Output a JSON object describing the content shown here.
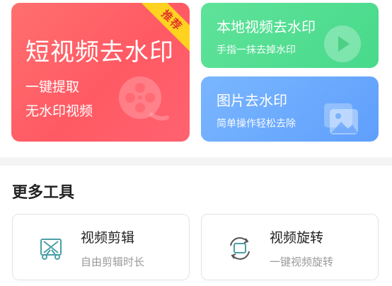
{
  "main_card": {
    "title": "短视频去水印",
    "line1": "一键提取",
    "line2": "无水印视频",
    "badge": "推荐",
    "icon": "film-reel-icon"
  },
  "local_card": {
    "title": "本地视频去水印",
    "subtitle": "手指一抹去掉水印",
    "icon": "play-icon"
  },
  "image_card": {
    "title": "图片去水印",
    "subtitle": "简单操作轻松去除",
    "icon": "gallery-icon"
  },
  "more_tools": {
    "title": "更多工具",
    "items": [
      {
        "name": "视频剪辑",
        "subtitle": "自由剪辑时长",
        "icon": "video-cut-icon"
      },
      {
        "name": "视频旋转",
        "subtitle": "一键视频旋转",
        "icon": "video-rotate-icon"
      }
    ]
  },
  "colors": {
    "main_card": "#ff5f66",
    "local_card": "#4fdd90",
    "image_card": "#6aa8fd",
    "badge": "#ffd21f",
    "badge_text": "#e0352b",
    "tool_icon": "#4aa0a6"
  }
}
